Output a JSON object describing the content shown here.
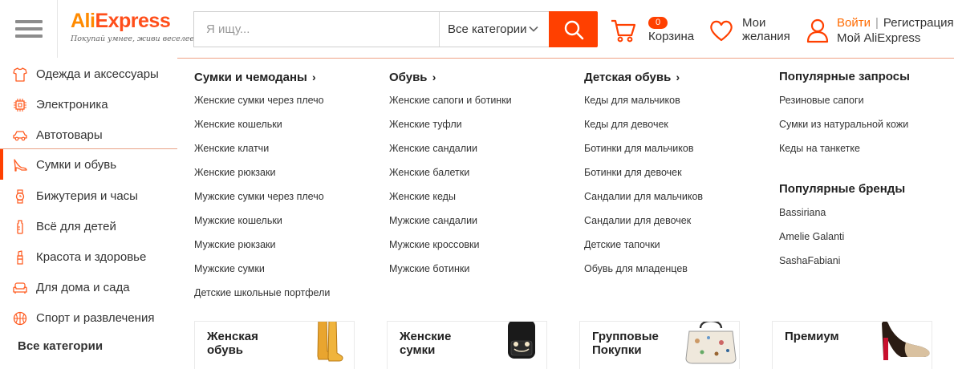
{
  "header": {
    "logo": {
      "ali": "Ali",
      "express": "Express",
      "tagline": "Покупай умнее, живи веселее!"
    },
    "search": {
      "placeholder": "Я ищу...",
      "category": "Все категории"
    },
    "cart": {
      "count": "0",
      "label": "Корзина"
    },
    "wishlist": {
      "line1": "Мои",
      "line2": "желания"
    },
    "account": {
      "login": "Войти",
      "separator": "|",
      "register": "Регистрация",
      "my": "Мой AliExpress"
    }
  },
  "sidebar": {
    "items": [
      {
        "label": "Одежда и аксессуары",
        "icon": "shirt-icon"
      },
      {
        "label": "Электроника",
        "icon": "chip-icon"
      },
      {
        "label": "Автотовары",
        "icon": "car-icon"
      },
      {
        "label": "Сумки и обувь",
        "icon": "shoe-icon"
      },
      {
        "label": "Бижутерия и часы",
        "icon": "watch-icon"
      },
      {
        "label": "Всё для детей",
        "icon": "bottle-icon"
      },
      {
        "label": "Красота и здоровье",
        "icon": "lipstick-icon"
      },
      {
        "label": "Для дома и сада",
        "icon": "sofa-icon"
      },
      {
        "label": "Спорт и развлечения",
        "icon": "ball-icon"
      }
    ],
    "all": "Все категории",
    "active_index": 3
  },
  "menu": {
    "columns": [
      {
        "title": "Сумки и чемоданы",
        "arrow": "›",
        "items": [
          "Женские сумки через плечо",
          "Женские кошельки",
          "Женские клатчи",
          "Женские рюкзаки",
          "Мужские сумки через плечо",
          "Мужские кошельки",
          "Мужские рюкзаки",
          "Мужские сумки",
          "Детские школьные портфели"
        ]
      },
      {
        "title": "Обувь",
        "arrow": "›",
        "items": [
          "Женские сапоги и ботинки",
          "Женские туфли",
          "Женские сандалии",
          "Женские балетки",
          "Женские кеды",
          "Мужские сандалии",
          "Мужские кроссовки",
          "Мужские ботинки"
        ]
      },
      {
        "title": "Детская обувь",
        "arrow": "›",
        "items": [
          "Кеды для мальчиков",
          "Кеды для девочек",
          "Ботинки для мальчиков",
          "Ботинки для девочек",
          "Сандалии для мальчиков",
          "Сандалии для девочек",
          "Детские тапочки",
          "Обувь для младенцев"
        ]
      }
    ],
    "popular_queries": {
      "title": "Популярные запросы",
      "items": [
        "Резиновые сапоги",
        "Сумки из натуральной кожи",
        "Кеды на танкетке"
      ]
    },
    "popular_brands": {
      "title": "Популярные бренды",
      "items": [
        "Bassiriana",
        "Amelie Galanti",
        "SashaFabiani"
      ]
    }
  },
  "promos": [
    {
      "title": "Женская обувь",
      "image": "yellow-boots"
    },
    {
      "title": "Женские сумки",
      "image": "black-backpack"
    },
    {
      "title": "Групповые Покупки",
      "image": "printed-bag"
    },
    {
      "title": "Премиум",
      "image": "high-heel"
    }
  ],
  "colors": {
    "accent": "#ff4000",
    "logo_orange": "#ff8a00",
    "border_accent": "#e8a187"
  }
}
